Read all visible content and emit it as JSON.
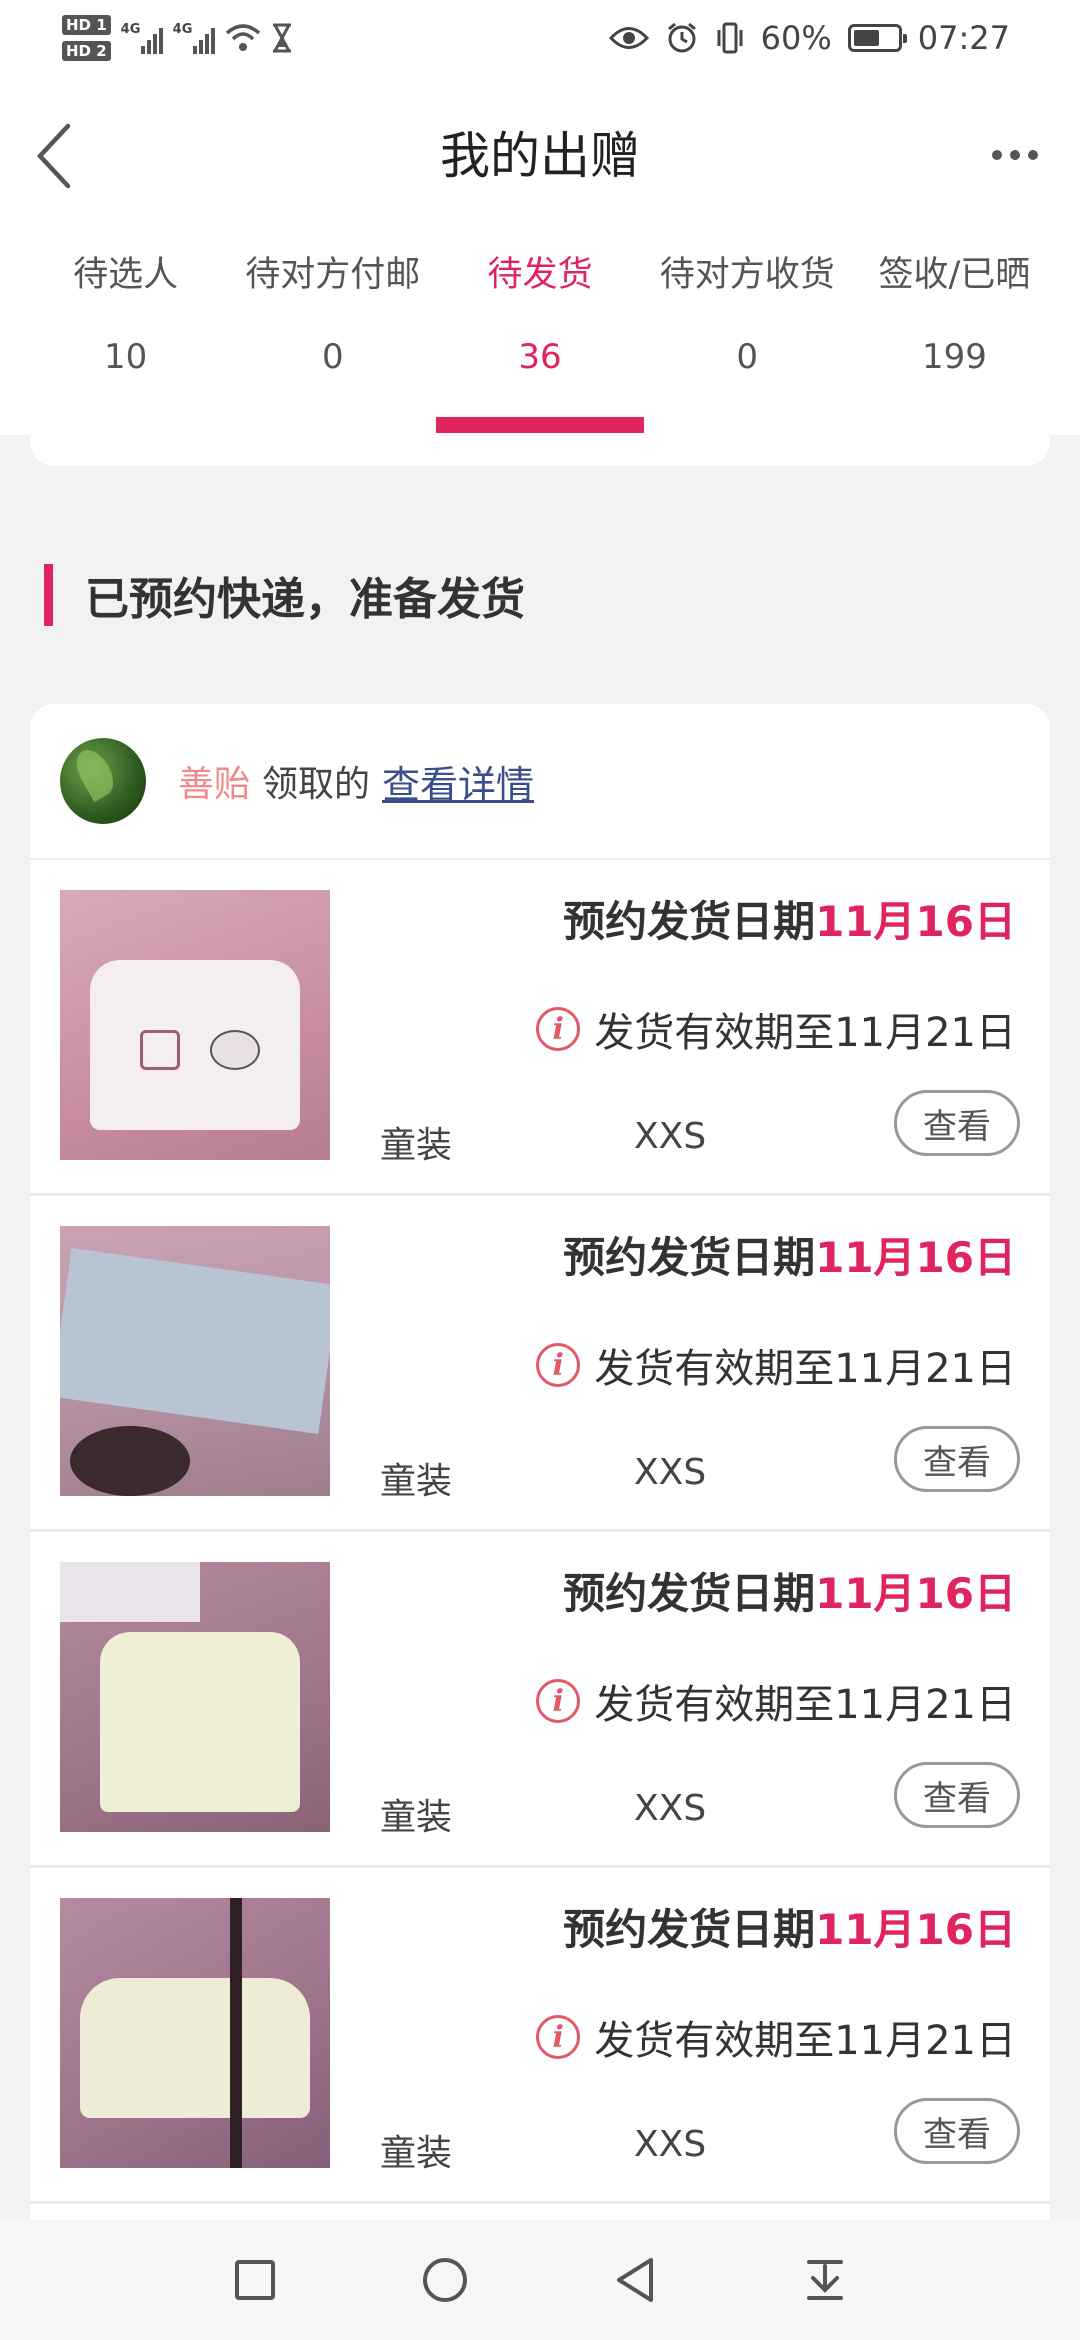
{
  "status_bar": {
    "hd1": "HD 1",
    "hd2": "HD 2",
    "net1": "4G",
    "net2": "4G",
    "battery_percent": "60%",
    "battery_level": 0.6,
    "time": "07:27",
    "icons": [
      "signal-icon",
      "wifi-icon",
      "hourglass-icon",
      "eye-icon",
      "alarm-icon",
      "vibrate-icon",
      "battery-icon"
    ]
  },
  "nav": {
    "title": "我的出赠"
  },
  "tabs": [
    {
      "label": "待选人",
      "count": "10",
      "active": false
    },
    {
      "label": "待对方付邮",
      "count": "0",
      "active": false
    },
    {
      "label": "待发货",
      "count": "36",
      "active": true
    },
    {
      "label": "待对方收货",
      "count": "0",
      "active": false
    },
    {
      "label": "签收/已晒",
      "count": "199",
      "active": false
    }
  ],
  "section": {
    "heading": "已预约快递，准备发货"
  },
  "donor": {
    "name": "善贻",
    "text": "领取的",
    "link": "查看详情"
  },
  "items": [
    {
      "date_label": "预约发货日期",
      "date": "11月16日",
      "valid": "发货有效期至11月21日",
      "category": "童装",
      "size": "XXS",
      "button": "查看"
    },
    {
      "date_label": "预约发货日期",
      "date": "11月16日",
      "valid": "发货有效期至11月21日",
      "category": "童装",
      "size": "XXS",
      "button": "查看"
    },
    {
      "date_label": "预约发货日期",
      "date": "11月16日",
      "valid": "发货有效期至11月21日",
      "category": "童装",
      "size": "XXS",
      "button": "查看"
    },
    {
      "date_label": "预约发货日期",
      "date": "11月16日",
      "valid": "发货有效期至11月21日",
      "category": "童装",
      "size": "XXS",
      "button": "查看"
    }
  ],
  "colors": {
    "accent": "#e0245e",
    "donor_name": "#f08a8a",
    "link": "#3a4f8a"
  }
}
